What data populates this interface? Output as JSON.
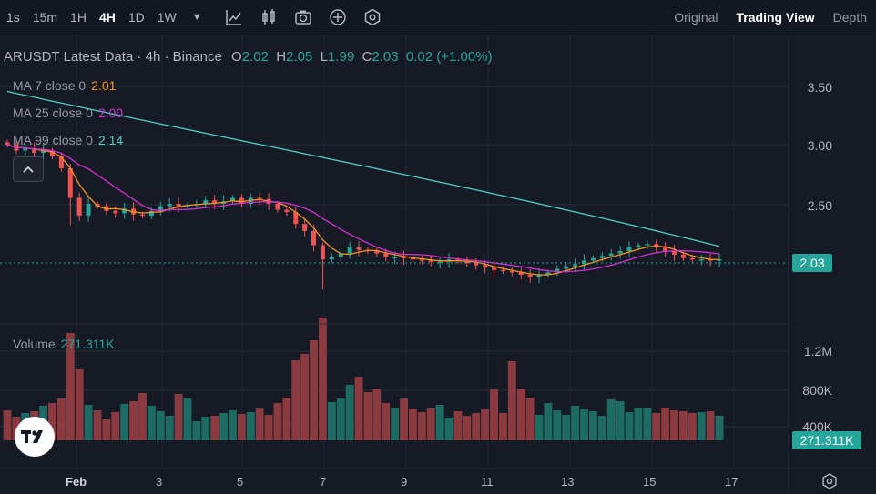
{
  "toolbar": {
    "intervals": [
      {
        "label": "1s"
      },
      {
        "label": "15m"
      },
      {
        "label": "1H"
      },
      {
        "label": "4H",
        "active": true
      },
      {
        "label": "1D"
      },
      {
        "label": "1W"
      }
    ],
    "interval_dropdown_icon": "caret-down-icon",
    "tools": [
      "indicators-icon",
      "candle-type-icon",
      "screenshot-icon",
      "add-icon",
      "settings-hex-icon"
    ],
    "views": [
      {
        "label": "Original"
      },
      {
        "label": "Trading View",
        "active": true
      },
      {
        "label": "Depth"
      }
    ]
  },
  "legend": {
    "title": "ARUSDT Latest Data · 4h · Binance",
    "o_label": "O",
    "o": "2.02",
    "h_label": "H",
    "h": "2.05",
    "l_label": "L",
    "l": "1.99",
    "c_label": "C",
    "c": "2.03",
    "change": "0.02",
    "change_pct": "(+1.00%)"
  },
  "mas": [
    {
      "label": "MA 7 close 0",
      "value": "2.01",
      "color": "#f7931a"
    },
    {
      "label": "MA 25 close 0",
      "value": "2.00",
      "color": "#d62ed6"
    },
    {
      "label": "MA 99 close 0",
      "value": "2.14",
      "color": "#4fd1c5"
    }
  ],
  "volume": {
    "label": "Volume",
    "value": "271.311K"
  },
  "price_axis": [
    "3.50",
    "3.00",
    "2.50"
  ],
  "volume_axis": [
    "1.2M",
    "800K",
    "400K"
  ],
  "last_price": "2.03",
  "last_volume": "271.311K",
  "x_axis": [
    {
      "label": "Feb",
      "bold": true
    },
    {
      "label": "3"
    },
    {
      "label": "5"
    },
    {
      "label": "7"
    },
    {
      "label": "9"
    },
    {
      "label": "11"
    },
    {
      "label": "13"
    },
    {
      "label": "15"
    },
    {
      "label": "17"
    }
  ],
  "colors": {
    "up": "#26a69a",
    "down": "#ef5350",
    "bg": "#161a25",
    "grid": "#2a2e39"
  },
  "chart_data": {
    "type": "candlestick",
    "series_price": [
      3.0,
      2.95,
      2.97,
      2.93,
      2.95,
      2.9,
      2.8,
      2.55,
      2.4,
      2.5,
      2.48,
      2.44,
      2.42,
      2.46,
      2.41,
      2.4,
      2.44,
      2.48,
      2.5,
      2.48,
      2.49,
      2.5,
      2.53,
      2.5,
      2.52,
      2.55,
      2.5,
      2.55,
      2.54,
      2.5,
      2.45,
      2.43,
      2.33,
      2.27,
      2.15,
      2.03,
      2.05,
      2.08,
      2.13,
      2.11,
      2.1,
      2.08,
      2.05,
      2.05,
      2.04,
      2.03,
      2.02,
      2.01,
      2.01,
      2.03,
      2.02,
      2.0,
      1.98,
      1.96,
      1.94,
      1.93,
      1.92,
      1.9,
      1.88,
      1.9,
      1.92,
      1.95,
      1.97,
      1.99,
      2.02,
      2.04,
      2.06,
      2.08,
      2.1,
      2.13,
      2.15,
      2.16,
      2.13,
      2.1,
      2.07,
      2.04,
      2.03,
      2.03,
      2.02,
      2.03
    ],
    "series_volume": [
      330,
      260,
      300,
      320,
      380,
      410,
      460,
      1180,
      780,
      390,
      330,
      230,
      310,
      400,
      430,
      520,
      380,
      320,
      270,
      510,
      460,
      210,
      260,
      270,
      300,
      330,
      290,
      310,
      350,
      280,
      410,
      470,
      880,
      950,
      1100,
      1350,
      420,
      460,
      610,
      700,
      530,
      560,
      410,
      360,
      460,
      340,
      310,
      350,
      390,
      250,
      320,
      270,
      300,
      340,
      560,
      300,
      870,
      560,
      470,
      280,
      410,
      330,
      280,
      380,
      340,
      320,
      270,
      450,
      430,
      310,
      360,
      360,
      300,
      360,
      330,
      320,
      300,
      310,
      320,
      271
    ]
  }
}
